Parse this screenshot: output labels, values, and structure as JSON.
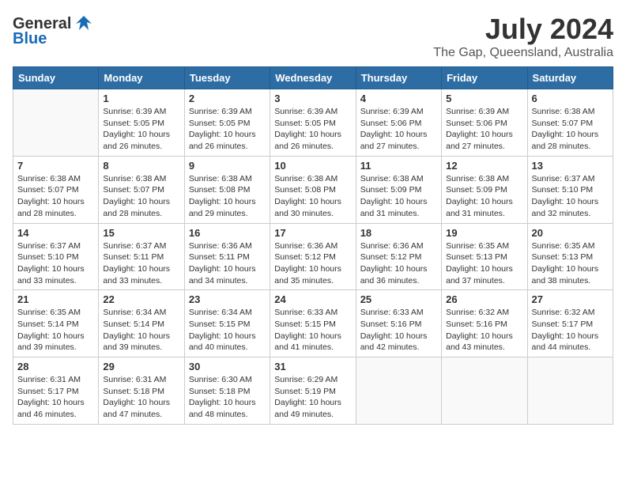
{
  "header": {
    "logo_general": "General",
    "logo_blue": "Blue",
    "month": "July 2024",
    "location": "The Gap, Queensland, Australia"
  },
  "weekdays": [
    "Sunday",
    "Monday",
    "Tuesday",
    "Wednesday",
    "Thursday",
    "Friday",
    "Saturday"
  ],
  "weeks": [
    [
      {
        "day": "",
        "sunrise": "",
        "sunset": "",
        "daylight": ""
      },
      {
        "day": "1",
        "sunrise": "Sunrise: 6:39 AM",
        "sunset": "Sunset: 5:05 PM",
        "daylight": "Daylight: 10 hours and 26 minutes."
      },
      {
        "day": "2",
        "sunrise": "Sunrise: 6:39 AM",
        "sunset": "Sunset: 5:05 PM",
        "daylight": "Daylight: 10 hours and 26 minutes."
      },
      {
        "day": "3",
        "sunrise": "Sunrise: 6:39 AM",
        "sunset": "Sunset: 5:05 PM",
        "daylight": "Daylight: 10 hours and 26 minutes."
      },
      {
        "day": "4",
        "sunrise": "Sunrise: 6:39 AM",
        "sunset": "Sunset: 5:06 PM",
        "daylight": "Daylight: 10 hours and 27 minutes."
      },
      {
        "day": "5",
        "sunrise": "Sunrise: 6:39 AM",
        "sunset": "Sunset: 5:06 PM",
        "daylight": "Daylight: 10 hours and 27 minutes."
      },
      {
        "day": "6",
        "sunrise": "Sunrise: 6:38 AM",
        "sunset": "Sunset: 5:07 PM",
        "daylight": "Daylight: 10 hours and 28 minutes."
      }
    ],
    [
      {
        "day": "7",
        "sunrise": "Sunrise: 6:38 AM",
        "sunset": "Sunset: 5:07 PM",
        "daylight": "Daylight: 10 hours and 28 minutes."
      },
      {
        "day": "8",
        "sunrise": "Sunrise: 6:38 AM",
        "sunset": "Sunset: 5:07 PM",
        "daylight": "Daylight: 10 hours and 28 minutes."
      },
      {
        "day": "9",
        "sunrise": "Sunrise: 6:38 AM",
        "sunset": "Sunset: 5:08 PM",
        "daylight": "Daylight: 10 hours and 29 minutes."
      },
      {
        "day": "10",
        "sunrise": "Sunrise: 6:38 AM",
        "sunset": "Sunset: 5:08 PM",
        "daylight": "Daylight: 10 hours and 30 minutes."
      },
      {
        "day": "11",
        "sunrise": "Sunrise: 6:38 AM",
        "sunset": "Sunset: 5:09 PM",
        "daylight": "Daylight: 10 hours and 31 minutes."
      },
      {
        "day": "12",
        "sunrise": "Sunrise: 6:38 AM",
        "sunset": "Sunset: 5:09 PM",
        "daylight": "Daylight: 10 hours and 31 minutes."
      },
      {
        "day": "13",
        "sunrise": "Sunrise: 6:37 AM",
        "sunset": "Sunset: 5:10 PM",
        "daylight": "Daylight: 10 hours and 32 minutes."
      }
    ],
    [
      {
        "day": "14",
        "sunrise": "Sunrise: 6:37 AM",
        "sunset": "Sunset: 5:10 PM",
        "daylight": "Daylight: 10 hours and 33 minutes."
      },
      {
        "day": "15",
        "sunrise": "Sunrise: 6:37 AM",
        "sunset": "Sunset: 5:11 PM",
        "daylight": "Daylight: 10 hours and 33 minutes."
      },
      {
        "day": "16",
        "sunrise": "Sunrise: 6:36 AM",
        "sunset": "Sunset: 5:11 PM",
        "daylight": "Daylight: 10 hours and 34 minutes."
      },
      {
        "day": "17",
        "sunrise": "Sunrise: 6:36 AM",
        "sunset": "Sunset: 5:12 PM",
        "daylight": "Daylight: 10 hours and 35 minutes."
      },
      {
        "day": "18",
        "sunrise": "Sunrise: 6:36 AM",
        "sunset": "Sunset: 5:12 PM",
        "daylight": "Daylight: 10 hours and 36 minutes."
      },
      {
        "day": "19",
        "sunrise": "Sunrise: 6:35 AM",
        "sunset": "Sunset: 5:13 PM",
        "daylight": "Daylight: 10 hours and 37 minutes."
      },
      {
        "day": "20",
        "sunrise": "Sunrise: 6:35 AM",
        "sunset": "Sunset: 5:13 PM",
        "daylight": "Daylight: 10 hours and 38 minutes."
      }
    ],
    [
      {
        "day": "21",
        "sunrise": "Sunrise: 6:35 AM",
        "sunset": "Sunset: 5:14 PM",
        "daylight": "Daylight: 10 hours and 39 minutes."
      },
      {
        "day": "22",
        "sunrise": "Sunrise: 6:34 AM",
        "sunset": "Sunset: 5:14 PM",
        "daylight": "Daylight: 10 hours and 39 minutes."
      },
      {
        "day": "23",
        "sunrise": "Sunrise: 6:34 AM",
        "sunset": "Sunset: 5:15 PM",
        "daylight": "Daylight: 10 hours and 40 minutes."
      },
      {
        "day": "24",
        "sunrise": "Sunrise: 6:33 AM",
        "sunset": "Sunset: 5:15 PM",
        "daylight": "Daylight: 10 hours and 41 minutes."
      },
      {
        "day": "25",
        "sunrise": "Sunrise: 6:33 AM",
        "sunset": "Sunset: 5:16 PM",
        "daylight": "Daylight: 10 hours and 42 minutes."
      },
      {
        "day": "26",
        "sunrise": "Sunrise: 6:32 AM",
        "sunset": "Sunset: 5:16 PM",
        "daylight": "Daylight: 10 hours and 43 minutes."
      },
      {
        "day": "27",
        "sunrise": "Sunrise: 6:32 AM",
        "sunset": "Sunset: 5:17 PM",
        "daylight": "Daylight: 10 hours and 44 minutes."
      }
    ],
    [
      {
        "day": "28",
        "sunrise": "Sunrise: 6:31 AM",
        "sunset": "Sunset: 5:17 PM",
        "daylight": "Daylight: 10 hours and 46 minutes."
      },
      {
        "day": "29",
        "sunrise": "Sunrise: 6:31 AM",
        "sunset": "Sunset: 5:18 PM",
        "daylight": "Daylight: 10 hours and 47 minutes."
      },
      {
        "day": "30",
        "sunrise": "Sunrise: 6:30 AM",
        "sunset": "Sunset: 5:18 PM",
        "daylight": "Daylight: 10 hours and 48 minutes."
      },
      {
        "day": "31",
        "sunrise": "Sunrise: 6:29 AM",
        "sunset": "Sunset: 5:19 PM",
        "daylight": "Daylight: 10 hours and 49 minutes."
      },
      {
        "day": "",
        "sunrise": "",
        "sunset": "",
        "daylight": ""
      },
      {
        "day": "",
        "sunrise": "",
        "sunset": "",
        "daylight": ""
      },
      {
        "day": "",
        "sunrise": "",
        "sunset": "",
        "daylight": ""
      }
    ]
  ]
}
